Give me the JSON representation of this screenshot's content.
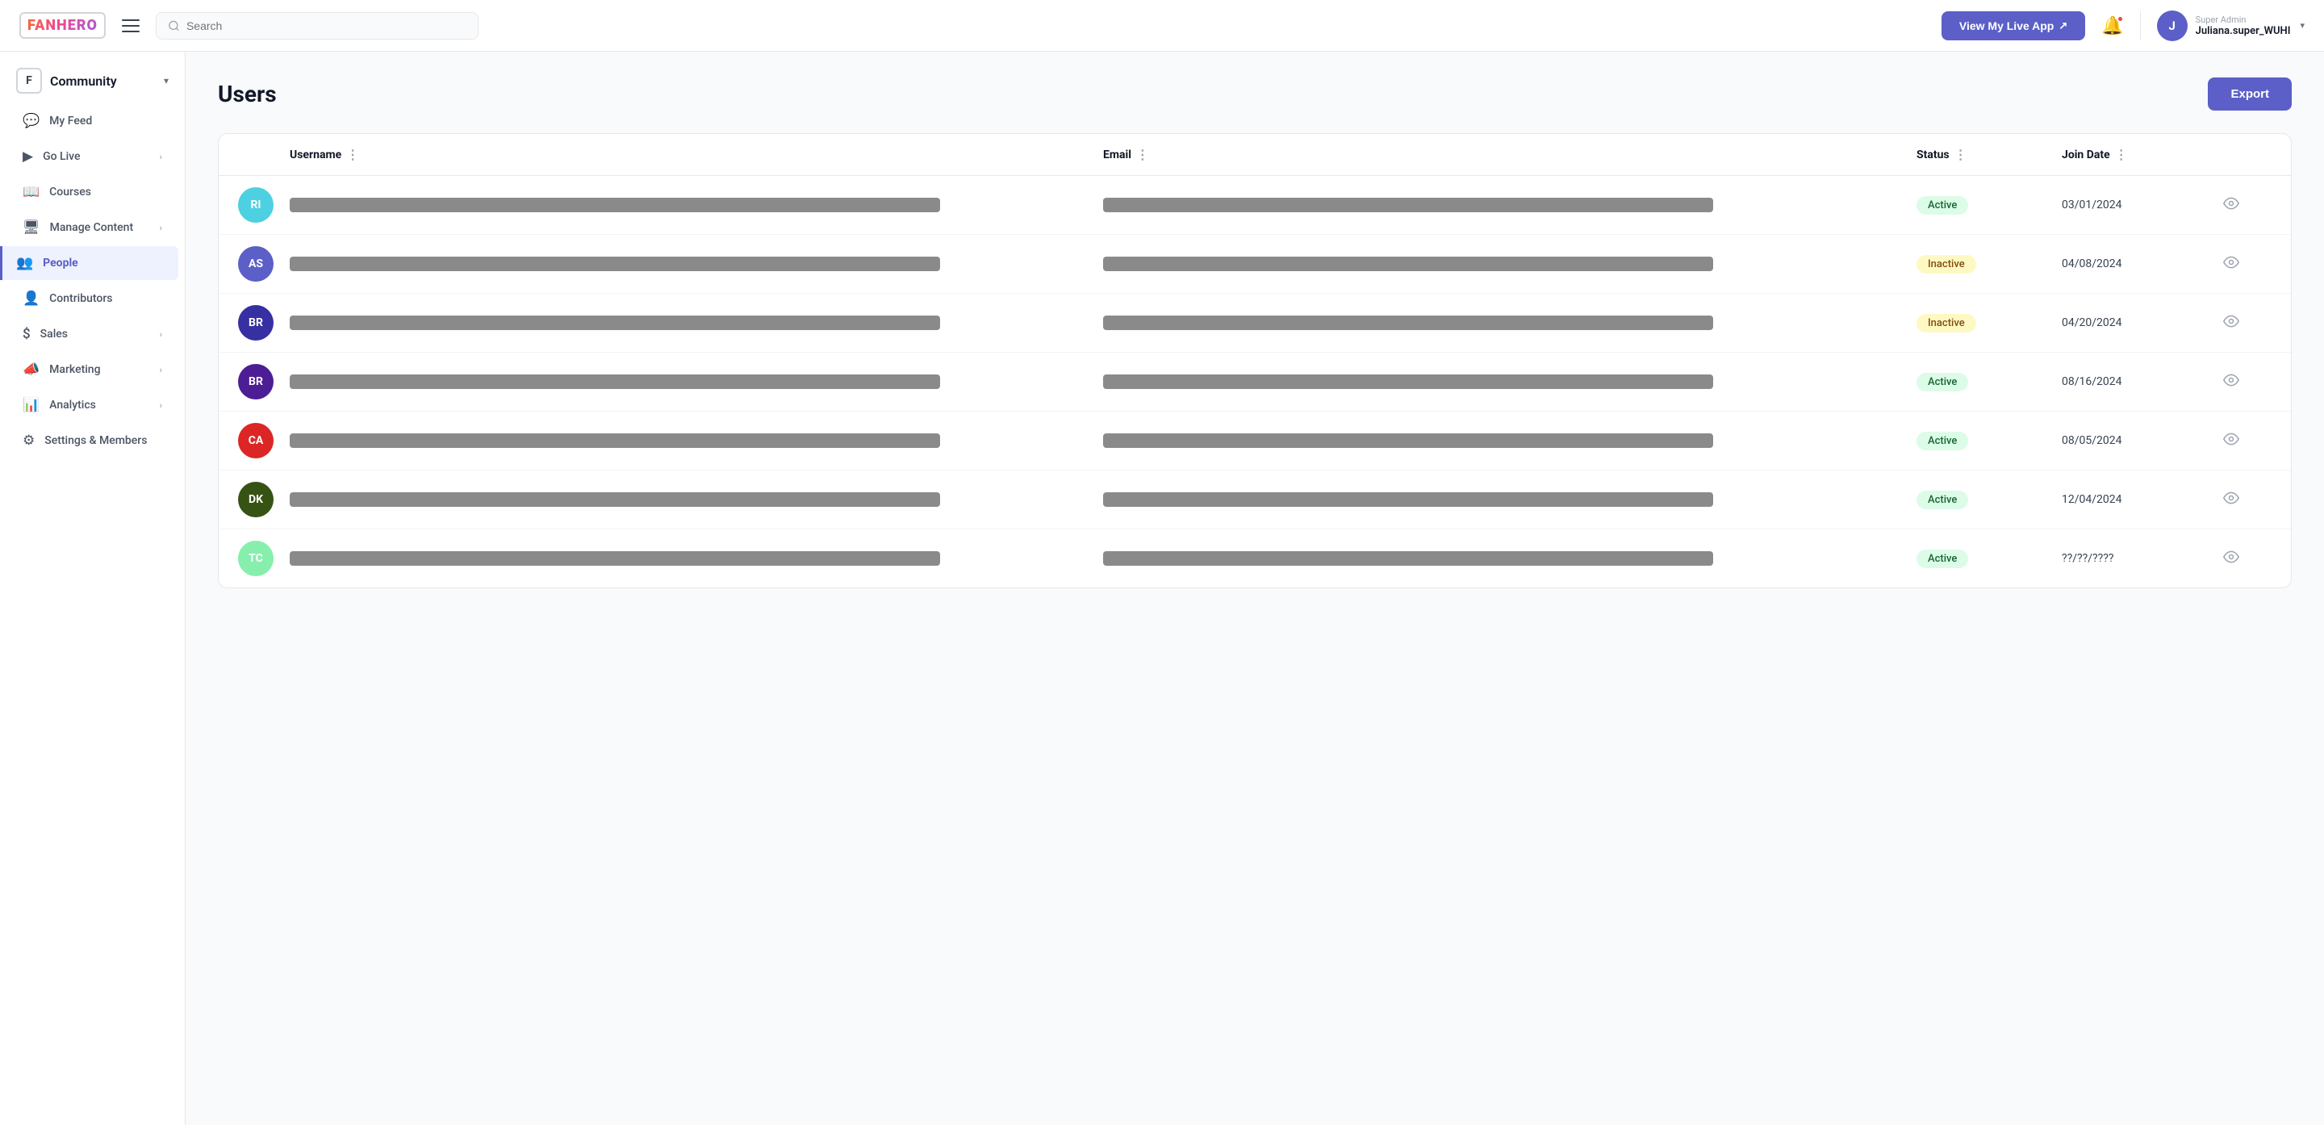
{
  "logo": "FANHERO",
  "topnav": {
    "search_placeholder": "Search",
    "view_live_label": "View My Live App",
    "user_role": "Super Admin",
    "user_name": "Juliana.super_WUHI",
    "user_initial": "J"
  },
  "sidebar": {
    "community_label": "Community",
    "items": [
      {
        "id": "my-feed",
        "label": "My Feed",
        "icon": "💬",
        "active": false,
        "has_chevron": false
      },
      {
        "id": "go-live",
        "label": "Go Live",
        "icon": "▶",
        "active": false,
        "has_chevron": true
      },
      {
        "id": "courses",
        "label": "Courses",
        "icon": "📖",
        "active": false,
        "has_chevron": false
      },
      {
        "id": "manage-content",
        "label": "Manage Content",
        "icon": "🖥",
        "active": false,
        "has_chevron": true
      },
      {
        "id": "people",
        "label": "People",
        "icon": "👥",
        "active": true,
        "has_chevron": false
      },
      {
        "id": "contributors",
        "label": "Contributors",
        "icon": "👤",
        "active": false,
        "has_chevron": false
      },
      {
        "id": "sales",
        "label": "Sales",
        "icon": "$",
        "active": false,
        "has_chevron": true
      },
      {
        "id": "marketing",
        "label": "Marketing",
        "icon": "📣",
        "active": false,
        "has_chevron": true
      },
      {
        "id": "analytics",
        "label": "Analytics",
        "icon": "📊",
        "active": false,
        "has_chevron": true
      },
      {
        "id": "settings",
        "label": "Settings & Members",
        "icon": "⚙",
        "active": false,
        "has_chevron": false
      }
    ]
  },
  "page": {
    "title": "Users",
    "export_label": "Export"
  },
  "table": {
    "columns": [
      {
        "id": "avatar",
        "label": ""
      },
      {
        "id": "username",
        "label": "Username"
      },
      {
        "id": "email",
        "label": "Email"
      },
      {
        "id": "status",
        "label": "Status"
      },
      {
        "id": "join_date",
        "label": "Join Date"
      },
      {
        "id": "actions",
        "label": ""
      }
    ],
    "rows": [
      {
        "initials": "RI",
        "avatar_color": "#4dd0e1",
        "username": "redacted",
        "email": "redacted",
        "status": "Active",
        "status_type": "active",
        "join_date": "03/01/2024"
      },
      {
        "initials": "AS",
        "avatar_color": "#5b5fc7",
        "username": "redacted",
        "email": "redacted",
        "status": "Inactive",
        "status_type": "inactive",
        "join_date": "04/08/2024"
      },
      {
        "initials": "BR",
        "avatar_color": "#3730a3",
        "username": "redacted",
        "email": "redacted",
        "status": "Inactive",
        "status_type": "inactive",
        "join_date": "04/20/2024"
      },
      {
        "initials": "BR",
        "avatar_color": "#4c1d95",
        "username": "redacted",
        "email": "redacted",
        "status": "Active",
        "status_type": "active",
        "join_date": "08/16/2024"
      },
      {
        "initials": "CA",
        "avatar_color": "#dc2626",
        "username": "redacted",
        "email": "redacted",
        "status": "Active",
        "status_type": "active",
        "join_date": "08/05/2024"
      },
      {
        "initials": "DK",
        "avatar_color": "#365314",
        "username": "redacted",
        "email": "redacted",
        "status": "Active",
        "status_type": "active",
        "join_date": "12/04/2024"
      },
      {
        "initials": "TC",
        "avatar_color": "#86efac",
        "username": "redacted",
        "email": "redacted",
        "status": "Active",
        "status_type": "active",
        "join_date": "??/??/????"
      }
    ]
  }
}
